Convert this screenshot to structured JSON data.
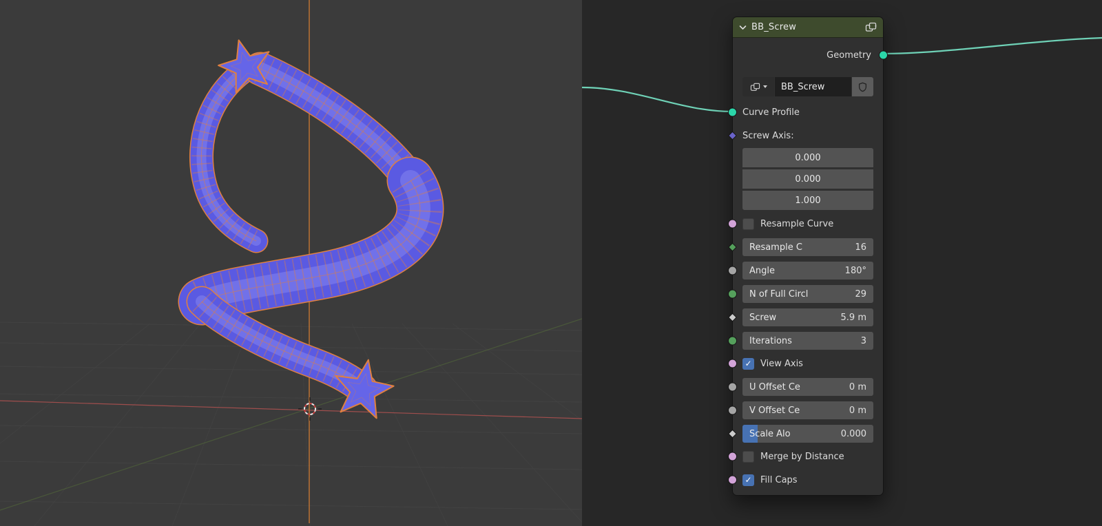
{
  "node": {
    "title": "BB_Screw",
    "output_label": "Geometry",
    "name_value": "BB_Screw",
    "labels": {
      "curve_profile": "Curve Profile",
      "screw_axis": "Screw Axis:",
      "resample_curve": "Resample Curve",
      "view_axis": "View Axis",
      "merge_by_distance": "Merge by Distance",
      "fill_caps": "Fill Caps"
    },
    "axis_values": [
      "0.000",
      "0.000",
      "1.000"
    ],
    "fields": {
      "resample_count": {
        "label": "Resample C",
        "value": "16"
      },
      "angle": {
        "label": "Angle",
        "value": "180°"
      },
      "n_of_full_circles": {
        "label": "N of Full Circl",
        "value": "29"
      },
      "screw": {
        "label": "Screw",
        "value": "5.9 m"
      },
      "iterations": {
        "label": "Iterations",
        "value": "3"
      },
      "u_offset": {
        "label": "U Offset Ce",
        "value": "0 m"
      },
      "v_offset": {
        "label": "V Offset Ce",
        "value": "0 m"
      },
      "scale_along": {
        "label": "Scale Alo",
        "value": "0.000"
      }
    },
    "checkboxes": {
      "resample_curve": false,
      "view_axis": true,
      "merge_by_distance": false,
      "fill_caps": true
    },
    "icons": {
      "collapse": "chevron-down-icon",
      "group": "node-group-icon",
      "fake_user": "shield-icon"
    }
  },
  "colors": {
    "viewport_bg": "#3b3b3b",
    "editor_bg": "#272727",
    "node_bg": "#303030",
    "node_header": "#3e4b2d",
    "field_bg": "#535353",
    "field_text": "#e8e8e8",
    "label_text": "#dcdcdc",
    "geometry_socket": "#2bd6a9",
    "vector_socket": "#6a63c9",
    "boolean_socket": "#d2a3d8",
    "int_socket": "#55a05c",
    "float_socket": "#a5a5a5",
    "value_socket": "#cccccc",
    "checkbox_checked": "#4772b3",
    "slider_fill": "#4772b3",
    "noodle": "#6fd2b7",
    "mesh_fill": "#5a5ae2",
    "mesh_wire": "#e08040",
    "axis_x": "#c25553",
    "axis_y": "#5c7a3a",
    "screw_axis_line": "#ce7a33"
  }
}
